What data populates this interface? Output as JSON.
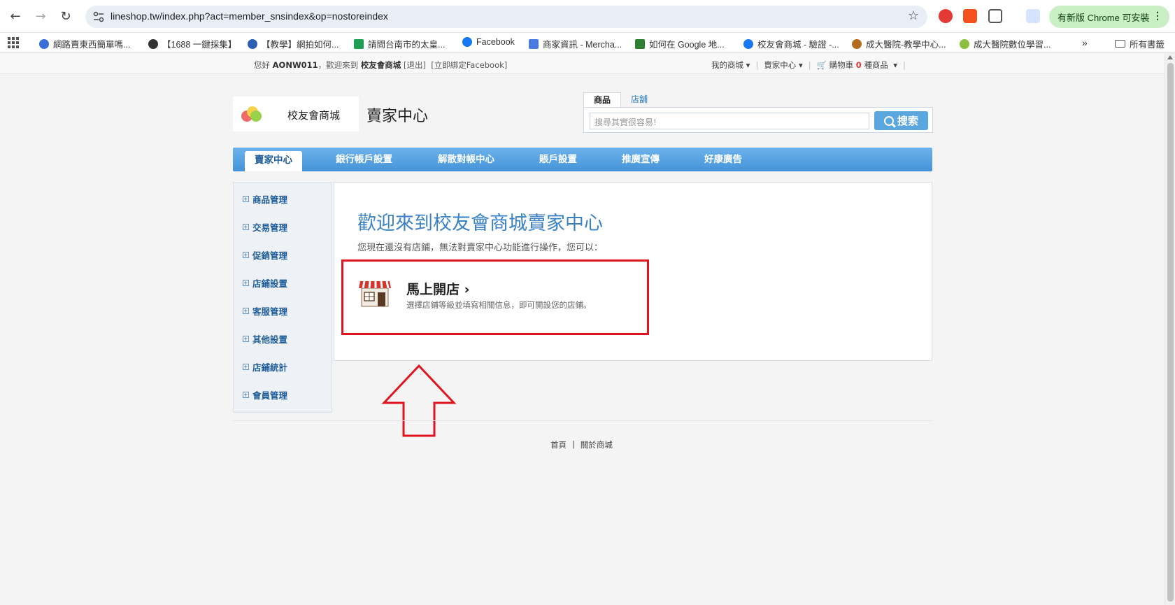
{
  "browser": {
    "url": "lineshop.tw/index.php?act=member_snsindex&op=nostoreindex",
    "update_button": "有新版 Chrome 可安裝",
    "bookmarks": [
      {
        "label": "網路賣東西簡單嗎...",
        "color": "#3b6fd8"
      },
      {
        "label": "【1688 一鍵採集】",
        "color": "#333333"
      },
      {
        "label": "【教學】網拍如何...",
        "color": "#2f5fb5"
      },
      {
        "label": "請問台南市的太皇...",
        "color": "#1f9d55"
      },
      {
        "label": "Facebook",
        "color": "#1877f2"
      },
      {
        "label": "商家資訊 - Mercha...",
        "color": "#4a7be0"
      },
      {
        "label": "如何在 Google 地...",
        "color": "#2e7d32"
      },
      {
        "label": "校友會商城 - 驗證 -...",
        "color": "#1877f2"
      },
      {
        "label": "成大醫院-教學中心...",
        "color": "#b36b1f"
      },
      {
        "label": "成大醫院數位學習...",
        "color": "#8bbf3f"
      }
    ],
    "all_bookmarks": "所有書籤"
  },
  "topbar": {
    "greeting_prefix": "您好",
    "username": "AONW011",
    "greeting_suffix": "，歡迎來到",
    "mall_name": "校友會商城",
    "logout": "[退出]",
    "bind_facebook": "[立即綁定Facebook]",
    "my_mall": "我的商城",
    "seller_center": "賣家中心",
    "cart_label": "購物車",
    "cart_count": "0",
    "cart_unit": "種商品"
  },
  "header": {
    "logo_name": "校友會商城",
    "title": "賣家中心",
    "search_tabs": [
      "商品",
      "店舖"
    ],
    "search_placeholder": "搜尋其實很容易!",
    "search_button": "搜索"
  },
  "nav": {
    "items": [
      "賣家中心",
      "銀行帳戶設置",
      "解散對帳中心",
      "賬戶設置",
      "推廣宣傳",
      "好康廣告"
    ]
  },
  "sidebar": {
    "items": [
      "商品管理",
      "交易管理",
      "促銷管理",
      "店鋪設置",
      "客服管理",
      "其他設置",
      "店鋪統計",
      "會員管理"
    ]
  },
  "content": {
    "welcome": "歡迎來到校友會商城賣家中心",
    "subtext": "您現在還沒有店鋪，無法對賣家中心功能進行操作，您可以：",
    "open_store_title": "馬上開店 ›",
    "open_store_desc": "選擇店鋪等級並填寫相關信息，即可開設您的店鋪。"
  },
  "footer": {
    "home": "首頁",
    "sep": "|",
    "about": "關於商城"
  },
  "colors": {
    "nav_blue": "#4493d8",
    "link_blue": "#1d5c99",
    "highlight_red": "#e0141e"
  }
}
